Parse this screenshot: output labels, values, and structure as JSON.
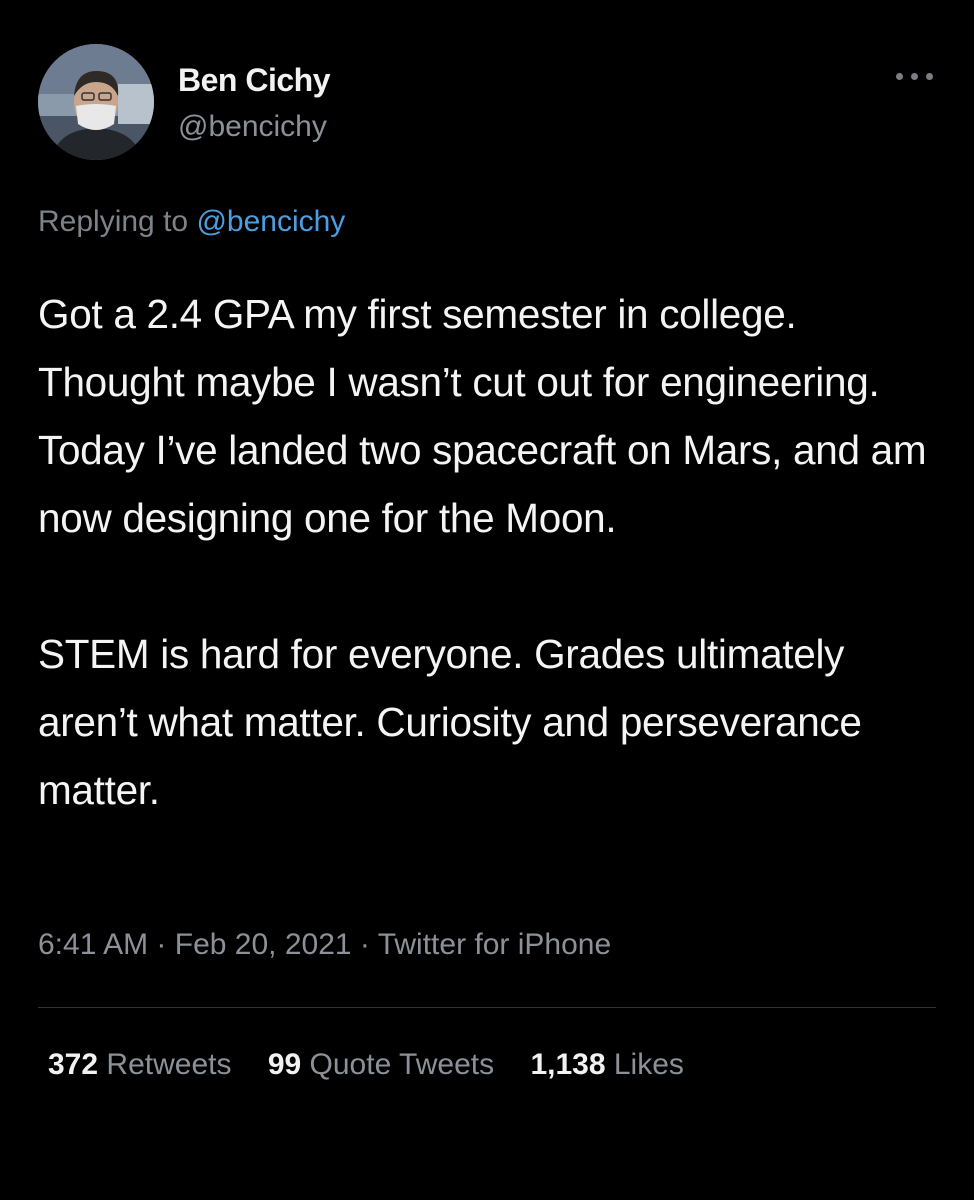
{
  "user": {
    "display_name": "Ben Cichy",
    "handle": "@bencichy",
    "avatar_icon": "profile-photo"
  },
  "header": {
    "more_icon": "more-horizontal-icon"
  },
  "reply": {
    "prefix": "Replying to",
    "mention": "@bencichy"
  },
  "tweet": {
    "paragraphs": [
      "Got a 2.4 GPA my first semester in college. Thought maybe I wasn’t cut out for engineering. Today I’ve landed two spacecraft on Mars, and am now designing one for the Moon.",
      "STEM is hard for everyone. Grades ultimately aren’t what matter.  Curiosity and perseverance matter."
    ]
  },
  "meta": {
    "time": "6:41 AM",
    "date": "Feb 20, 2021",
    "source": "Twitter for iPhone",
    "separator": "·"
  },
  "stats": {
    "retweets": {
      "count": "372",
      "label": "Retweets"
    },
    "quotes": {
      "count": "99",
      "label": "Quote Tweets"
    },
    "likes": {
      "count": "1,138",
      "label": "Likes"
    }
  },
  "colors": {
    "background": "#000000",
    "text": "#f4f4f4",
    "secondary": "#8b9197",
    "link": "#4d9ee0",
    "divider": "#2f3336"
  }
}
